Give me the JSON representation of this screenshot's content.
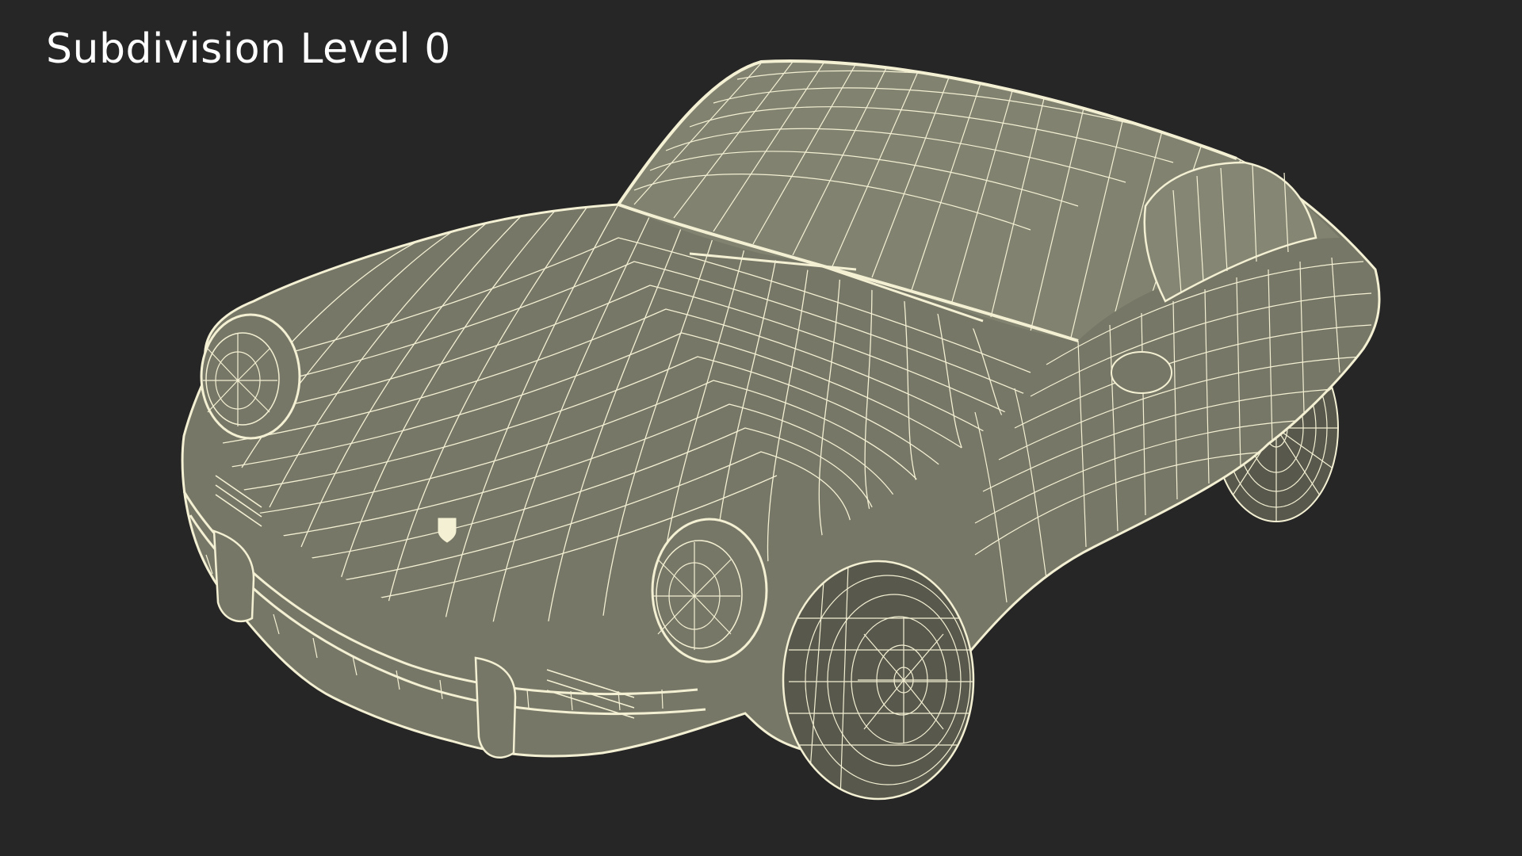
{
  "caption": "Subdivision Level 0",
  "colors": {
    "background": "#262626",
    "body_fill": "#767766",
    "body_fill_light": "#868875",
    "wire": "#f4f0d4",
    "tire": "#58594c",
    "caption_text": "#ffffff"
  }
}
